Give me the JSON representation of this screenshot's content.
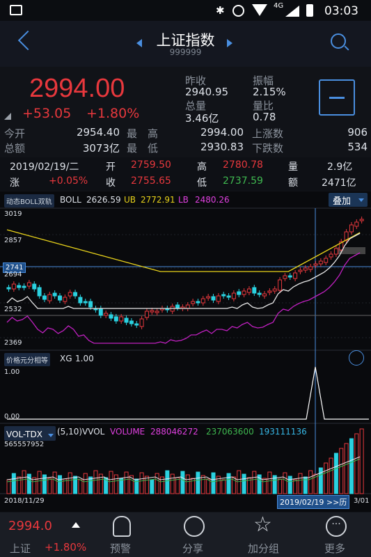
{
  "status": {
    "time": "03:03",
    "network": "4G"
  },
  "header": {
    "title": "上证指数",
    "code": "999999"
  },
  "quote": {
    "price": "2994.00",
    "change": "+53.05",
    "change_pct": "+1.80%",
    "prev_close_label": "昨收",
    "prev_close": "2940.95",
    "amplitude_label": "振幅",
    "amplitude": "2.15%",
    "volume_label": "总量",
    "volume": "3.46亿",
    "vol_ratio_label": "量比",
    "vol_ratio": "0.78"
  },
  "stats": [
    {
      "l1": "今开",
      "v1": "2954.40",
      "l2": "最　高",
      "v2": "2994.00",
      "l3": "上涨数",
      "v3": "906"
    },
    {
      "l1": "总额",
      "v1": "3073亿",
      "l2": "最　低",
      "v2": "2930.83",
      "l3": "下跌数",
      "v3": "534"
    }
  ],
  "day": {
    "date": "2019/02/19/二",
    "open_label": "开",
    "open": "2759.50",
    "high_label": "高",
    "high": "2780.78",
    "vol_label": "量",
    "vol": "2.9亿",
    "chg_label": "涨",
    "chg": "+0.05%",
    "close_label": "收",
    "close": "2755.65",
    "low_label": "低",
    "low": "2737.59",
    "amt_label": "额",
    "amt": "2471亿"
  },
  "boll": {
    "tag": "动态BOLL双轨",
    "label": "BOLL",
    "value": "2626.59",
    "ub_label": "UB",
    "ub": "2772.91",
    "lb_label": "LB",
    "lb": "2480.26",
    "overlay": "叠加",
    "y_top": "3019",
    "y_2": "2857",
    "y_3": "2741",
    "y_4": "2694",
    "y_5": "2532",
    "y_bot": "2369"
  },
  "xg": {
    "tag": "价格元分相等",
    "label": "XG",
    "value": "1.00",
    "y_top": "1.00",
    "y_bot": "0.00"
  },
  "vol": {
    "tag": "VOL-TDX",
    "params": "(5,10)",
    "name": "VVOL",
    "vol_label": "VOLUME",
    "v1": "288046272",
    "v2": "237063600",
    "v3": "193111136",
    "y_top": "565557952"
  },
  "xaxis": {
    "start": "2018/11/29",
    "cursor": "2019/02/19 >>历",
    "end": "3/01"
  },
  "bottom": {
    "price": "2994.0",
    "name": "上证",
    "pct": "+1.80%",
    "items": [
      "预警",
      "分享",
      "加分组",
      "更多"
    ]
  },
  "colors": {
    "up": "#e8383d",
    "down": "#2ad1e0",
    "ub": "#e8d21a",
    "mid": "#e8e8e8",
    "lb": "#c020c0"
  }
}
